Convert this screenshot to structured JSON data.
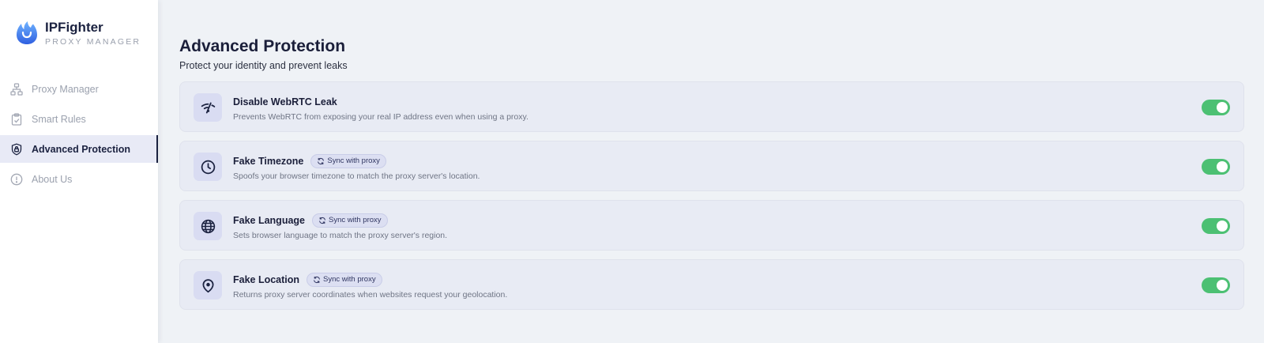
{
  "brand": {
    "name": "IPFighter",
    "subtitle": "PROXY MANAGER"
  },
  "sidebar": {
    "items": [
      {
        "label": "Proxy Manager",
        "icon": "network-icon",
        "active": false
      },
      {
        "label": "Smart Rules",
        "icon": "clipboard-icon",
        "active": false
      },
      {
        "label": "Advanced Protection",
        "icon": "shield-lock-icon",
        "active": true
      },
      {
        "label": "About Us",
        "icon": "info-icon",
        "active": false
      }
    ]
  },
  "main": {
    "title": "Advanced Protection",
    "subtitle": "Protect your identity and prevent leaks",
    "cards": [
      {
        "title": "Disable WebRTC Leak",
        "badge": "",
        "description": "Prevents WebRTC from exposing your real IP address even when using a proxy.",
        "icon": "wifi-off-icon",
        "enabled": true
      },
      {
        "title": "Fake Timezone",
        "badge": "Sync with proxy",
        "description": "Spoofs your browser timezone to match the proxy server's location.",
        "icon": "clock-icon",
        "enabled": true
      },
      {
        "title": "Fake Language",
        "badge": "Sync with proxy",
        "description": "Sets browser language to match the proxy server's region.",
        "icon": "globe-icon",
        "enabled": true
      },
      {
        "title": "Fake Location",
        "badge": "Sync with proxy",
        "description": "Returns proxy server coordinates when websites request your geolocation.",
        "icon": "location-pin-icon",
        "enabled": true
      }
    ]
  },
  "colors": {
    "accent": "#1b2240",
    "toggle_on": "#4cc073",
    "background": "#eff2f6"
  }
}
